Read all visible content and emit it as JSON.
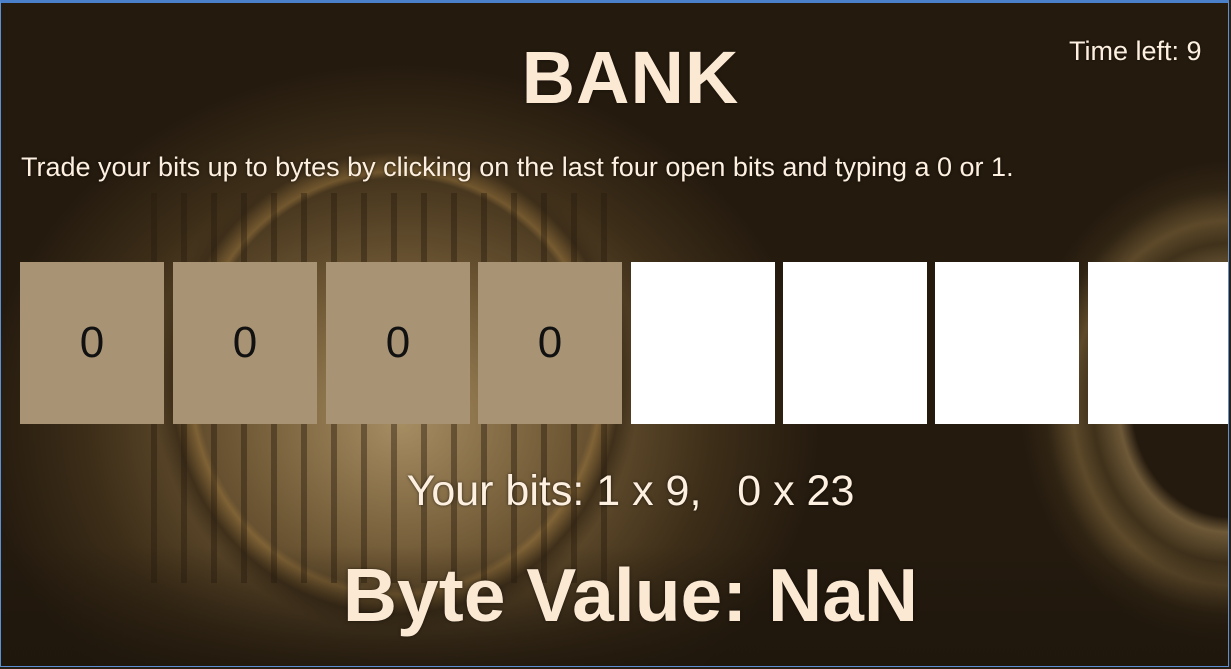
{
  "header": {
    "title": "BANK",
    "timer": "Time left: 9"
  },
  "instructions": "Trade your bits up to bytes by clicking on the last four open bits and typing a 0 or 1.",
  "bits": [
    {
      "value": "0",
      "state": "filled"
    },
    {
      "value": "0",
      "state": "filled"
    },
    {
      "value": "0",
      "state": "filled"
    },
    {
      "value": "0",
      "state": "filled"
    },
    {
      "value": "",
      "state": "open"
    },
    {
      "value": "",
      "state": "open"
    },
    {
      "value": "",
      "state": "open"
    },
    {
      "value": "",
      "state": "open"
    }
  ],
  "inventory": {
    "text": "Your bits: 1 x 9,   0 x 23"
  },
  "result": {
    "text": "Byte Value: NaN"
  },
  "colors": {
    "filled_bit": "#a89474",
    "open_bit": "#ffffff",
    "text": "#fbe9d4",
    "frame_border": "#5b8fd6"
  }
}
